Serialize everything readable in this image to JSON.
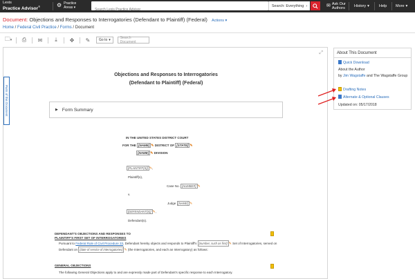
{
  "topbar": {
    "brand_line1": "Lexis",
    "brand_line2": "Practice Advisor",
    "brand_mark": "®",
    "areas_line1": "Practice",
    "areas_line2": "Areas",
    "search_placeholder": "Search Lexis Practice Advisor",
    "scope_label": "Search: Everything",
    "ask_line1": "Ask Our",
    "ask_line2": "Authors",
    "history_label": "History",
    "help_label": "Help",
    "more_label": "More"
  },
  "title": {
    "prefix": "Document:",
    "text": "Objections and Responses to Interrogatories (Defendant to Plaintiff) (Federal)",
    "actions_label": "Actions"
  },
  "breadcrumb": {
    "items": [
      "Home",
      "Federal Civil Practice",
      "Forms"
    ],
    "current": "Document"
  },
  "toolbar": {
    "goto_label": "Go to",
    "search_placeholder": "Search Document"
  },
  "side_tab_label": "Parts of this Document",
  "document": {
    "title_line1": "Objections and Responses to Interrogatories",
    "title_line2": "(Defendant to Plaintiff) (Federal)",
    "summary_label": "Form Summary",
    "court": "IN THE UNITED STATES DISTRICT COURT",
    "for_the": "FOR THE",
    "name_ph": "[NAME]",
    "district_of": "DISTRICT OF",
    "state_ph": "[STATE]",
    "division_name_ph": "[NAME]",
    "division": "DIVISION",
    "plaintiffs_ph": "[PLAINTIFF(S)]",
    "plaintiffs_label": "Plaintiff(s),",
    "case_no": "Case No.",
    "number_ph": "[NUMBER]",
    "v": "v.",
    "judge": "Judge",
    "judge_name_ph": "[NAME]",
    "defendants_ph": "[DEFENDANT(S)]",
    "defendants_label": "Defendant(s).",
    "heading1": "DEFENDANT'S OBJECTIONS AND RESPONSES TO",
    "heading2": "PLAINTIFF'S FIRST SET OF INTERROGATORIES",
    "para1_a": "Pursuant to",
    "para1_link": "Federal Rule of Civil Procedure 33",
    "para1_b": ", Defendant hereby objects and responds to Plaintiff's",
    "para1_ph1": "[number, such as first]",
    "para1_c": "Set of",
    "para1_d": "Interrogatories, served on Defendant on",
    "para1_ph2": "[date of service of interrogatories]",
    "para1_e": "(the Interrogatories, and each an Interrogatory) as",
    "para1_f": "follows:",
    "general_heading": "GENERAL OBJECTIONS",
    "general_text": "The following General Objections apply to and are expressly made part of Defendant's specific response to each Interrogatory."
  },
  "about": {
    "header": "About This Document",
    "quick_download": "Quick Download",
    "about_author": "About the Author",
    "by": "by",
    "author1": "Jim Wagstaffe",
    "and_text": "and The Wagstaffe Group",
    "drafting_notes": "Drafting Notes",
    "alternate_clauses": "Alternate & Optional Clauses",
    "updated": "Updated on: 05/17/2018"
  },
  "colors": {
    "topbar": "#2b2b2b",
    "accent_red": "#d9232d",
    "link_blue": "#2a6ebb",
    "note_yellow": "#f3c000",
    "arrow_red": "#e02020"
  }
}
